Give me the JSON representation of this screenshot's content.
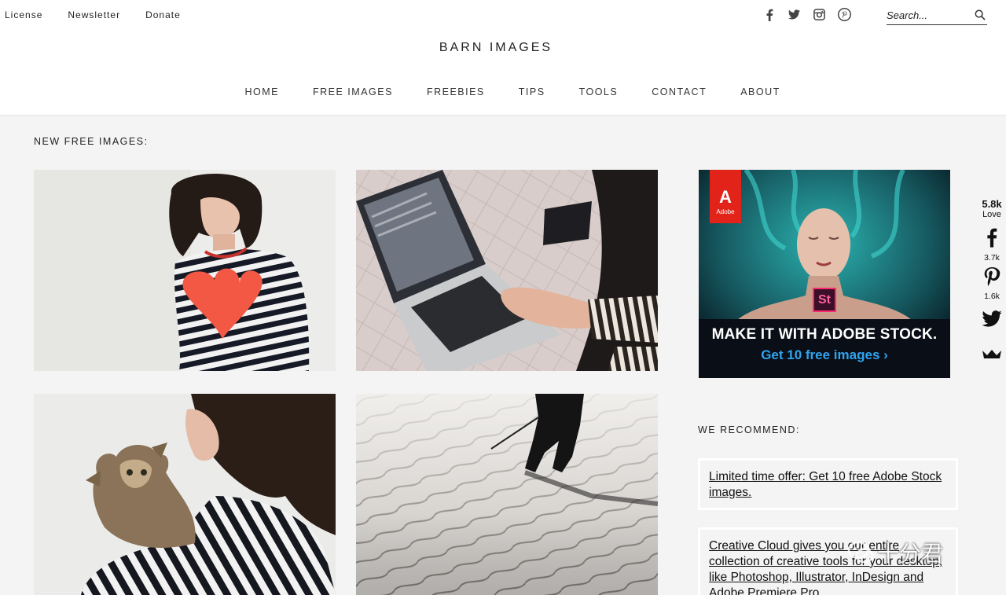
{
  "header": {
    "top_links": [
      "License",
      "Newsletter",
      "Donate"
    ],
    "social_icons": [
      "facebook-icon",
      "twitter-icon",
      "instagram-icon",
      "pinterest-icon"
    ],
    "search_placeholder": "Search...",
    "site_title": "BARN IMAGES",
    "nav": [
      "HOME",
      "FREE IMAGES",
      "FREEBIES",
      "TIPS",
      "TOOLS",
      "CONTACT",
      "ABOUT"
    ]
  },
  "main": {
    "section_title": "NEW FREE IMAGES:",
    "thumbnails": [
      {
        "name": "woman-heart-shirt-photo"
      },
      {
        "name": "laptop-typing-photo"
      },
      {
        "name": "woman-holding-cat-photo"
      },
      {
        "name": "skier-snow-photo"
      }
    ]
  },
  "sidebar": {
    "ad": {
      "logo_letter": "A",
      "logo_word": "Adobe",
      "st_label": "St",
      "headline": "MAKE IT WITH ADOBE STOCK.",
      "cta": "Get 10 free images ›"
    },
    "recommend_title": "WE RECOMMEND:",
    "recommendations": [
      "Limited time offer: Get 10 free Adobe Stock images.",
      "Creative Cloud gives you our entire collection of creative tools for your desktop, like Photoshop, Illustrator, InDesign and Adobe Premiere Pro."
    ]
  },
  "share_bar": {
    "total": "5.8k",
    "total_label": "Love",
    "facebook_count": "3.7k",
    "pinterest_count": "1.6k"
  },
  "watermark": {
    "text": "十分君"
  },
  "colors": {
    "page_bg": "#f4f4f4",
    "header_bg": "#ffffff",
    "adobe_red": "#e2231a",
    "ad_cta_blue": "#2fa4ef"
  }
}
